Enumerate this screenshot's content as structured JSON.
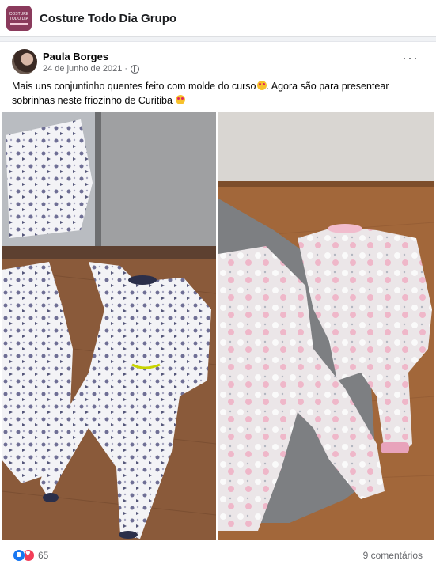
{
  "group": {
    "name": "Costure Todo Dia Grupo",
    "logo_text": "COSTURE TODO DIA"
  },
  "post": {
    "author": "Paula Borges",
    "date": "24 de junho de 2021",
    "text_1": "Mais uns conjuntinho quentes feito com molde do curso",
    "text_2": ". Agora são para presentear sobrinhas neste friozinho de Curitiba",
    "reactions_count": "65",
    "comments_count": "9 comentários"
  },
  "colors": {
    "accent": "#1877f2",
    "love": "#f33e58",
    "logo": "#8a3a5c"
  }
}
